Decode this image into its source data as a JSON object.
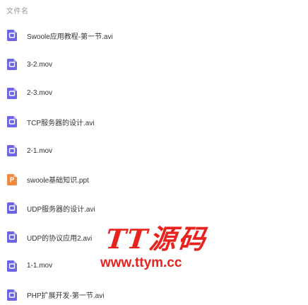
{
  "header": {
    "column_label": "文件名"
  },
  "files": [
    {
      "name": "Swoole应用教程-第一节.avi",
      "icon": "video-file-icon",
      "color": "#6c63e6"
    },
    {
      "name": "3-2.mov",
      "icon": "video-file-icon",
      "color": "#6c63e6"
    },
    {
      "name": "2-3.mov",
      "icon": "video-file-icon",
      "color": "#6c63e6"
    },
    {
      "name": "TCP服务器的设计.avi",
      "icon": "video-file-icon",
      "color": "#6c63e6"
    },
    {
      "name": "2-1.mov",
      "icon": "video-file-icon",
      "color": "#6c63e6"
    },
    {
      "name": "swoole基础知识.ppt",
      "icon": "ppt-file-icon",
      "color": "#f08a3e"
    },
    {
      "name": "UDP服务器的设计.avi",
      "icon": "video-file-icon",
      "color": "#6c63e6"
    },
    {
      "name": "UDP的协议应用2.avi",
      "icon": "video-file-icon",
      "color": "#6c63e6"
    },
    {
      "name": "1-1.mov",
      "icon": "video-file-icon",
      "color": "#6c63e6"
    },
    {
      "name": "PHP扩展开发-第一节.avi",
      "icon": "video-file-icon",
      "color": "#6c63e6"
    }
  ],
  "watermark": {
    "logo_text": "TT源码",
    "url_text": "www.ttym.cc",
    "color": "#e8221c"
  }
}
